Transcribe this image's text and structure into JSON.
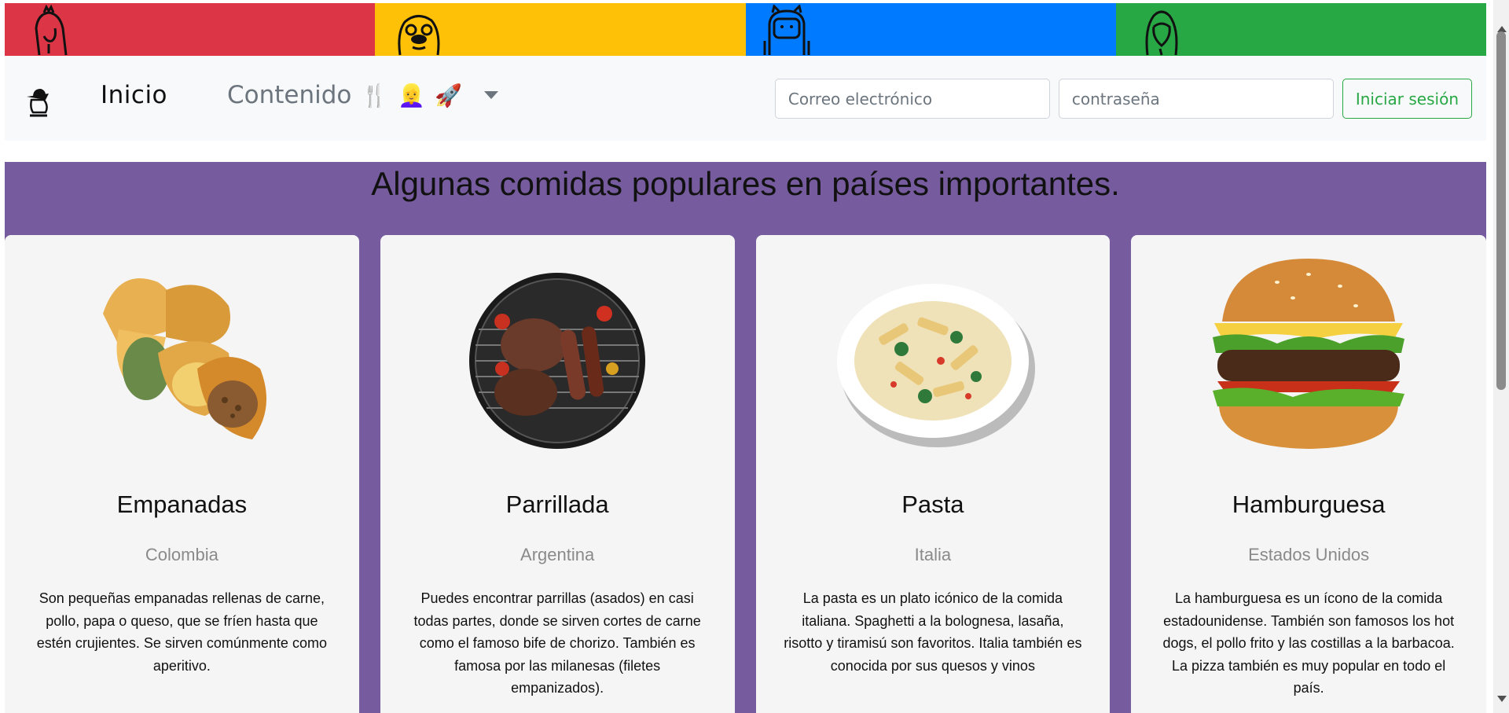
{
  "topbar": {
    "bands": [
      {
        "color": "#dc3545",
        "icon": "princess-bubblegum-icon"
      },
      {
        "color": "#ffc107",
        "icon": "jake-dog-icon"
      },
      {
        "color": "#007bff",
        "icon": "finn-human-icon"
      },
      {
        "color": "#28a745",
        "icon": "marceline-icon"
      }
    ]
  },
  "navbar": {
    "brand_icon": "hat-character-icon",
    "home_label": "Inicio",
    "content_label": "Contenido",
    "content_emojis": [
      "🍴",
      "👱‍♀️",
      "🚀"
    ],
    "email_placeholder": "Correo electrónico",
    "password_placeholder": "contraseña",
    "login_label": "Iniciar sesión"
  },
  "section": {
    "title": "Algunas comidas populares en países importantes.",
    "background": "#765c9e"
  },
  "cards": [
    {
      "title": "Empanadas",
      "country": "Colombia",
      "text": "Son pequeñas empanadas rellenas de carne, pollo, papa o queso, que se fríen hasta que estén crujientes. Se sirven comúnmente como aperitivo.",
      "image": "empanadas-image"
    },
    {
      "title": "Parrillada",
      "country": "Argentina",
      "text": "Puedes encontrar parrillas (asados) en casi todas partes, donde se sirven cortes de carne como el famoso bife de chorizo. También es famosa por las milanesas (filetes empanizados).",
      "image": "parrillada-image"
    },
    {
      "title": "Pasta",
      "country": "Italia",
      "text": "La pasta es un plato icónico de la comida italiana. Spaghetti a la bolognesa, lasaña, risotto y tiramisú son favoritos. Italia también es conocida por sus quesos y vinos",
      "image": "pasta-image"
    },
    {
      "title": "Hamburguesa",
      "country": "Estados Unidos",
      "text": "La hamburguesa es un ícono de la comida estadounidense. También son famosos los hot dogs, el pollo frito y las costillas a la barbacoa. La pizza también es muy popular en todo el país.",
      "image": "hamburguesa-image"
    }
  ]
}
